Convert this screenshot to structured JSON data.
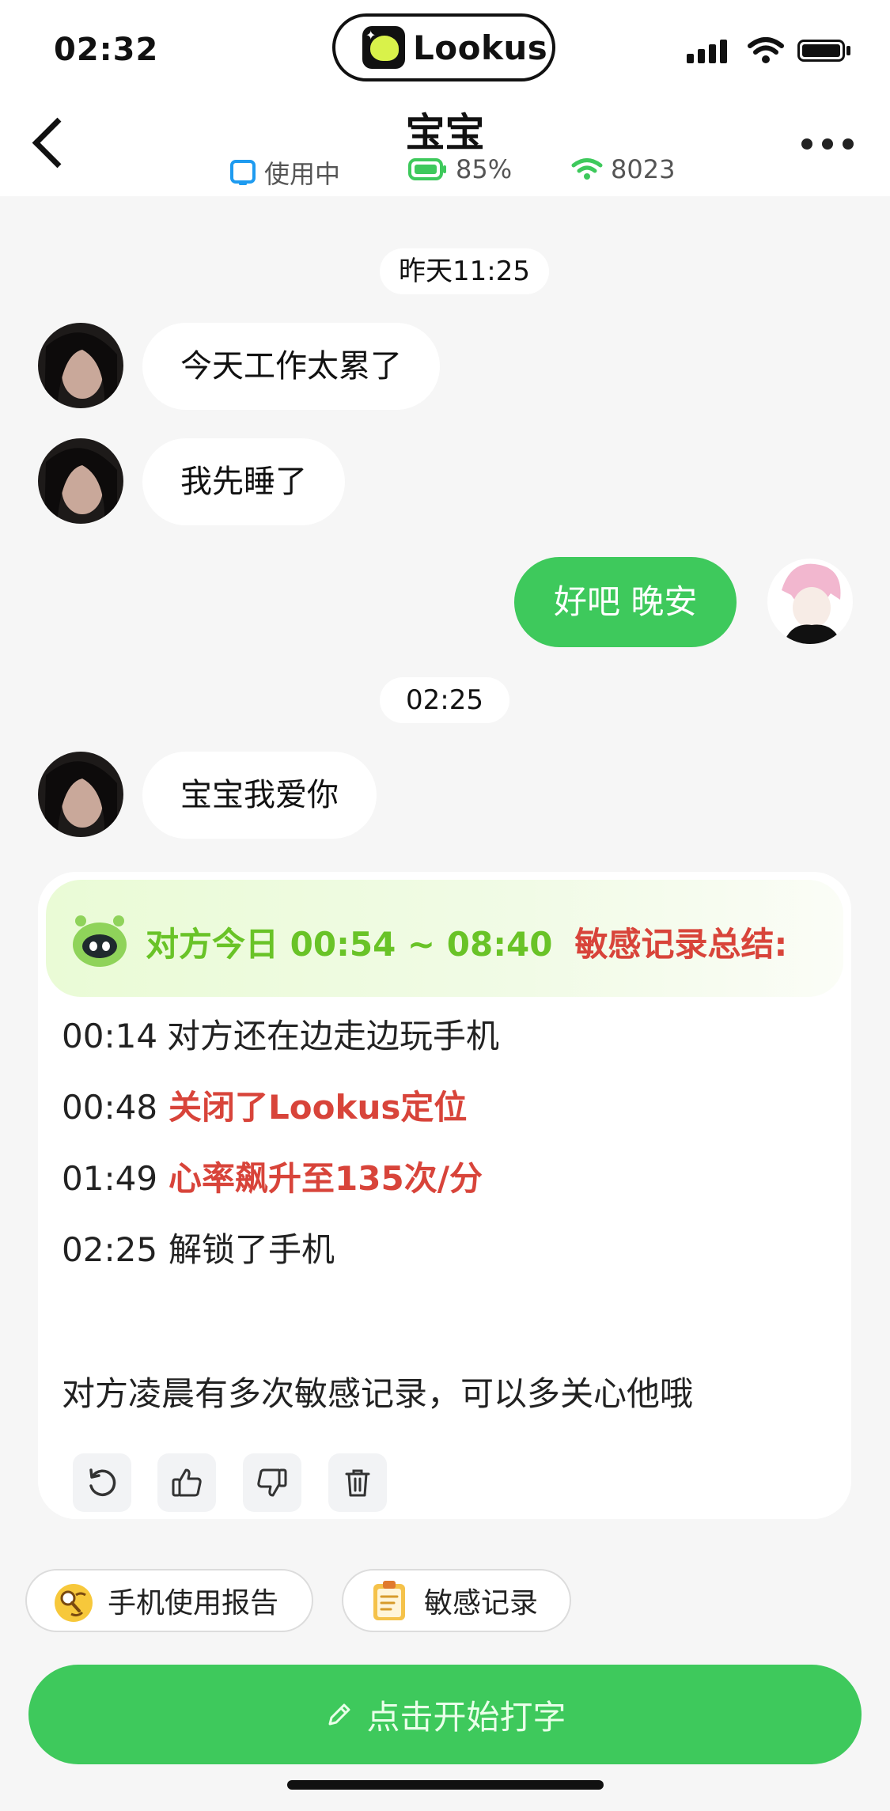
{
  "status_bar": {
    "time": "02:32"
  },
  "brand": {
    "name": "Lookus"
  },
  "header": {
    "title": "宝宝",
    "device_status": "使用中",
    "battery": "85%",
    "wifi": "8023"
  },
  "messages": [
    {
      "type": "timestamp",
      "text": "昨天11:25"
    },
    {
      "type": "incoming",
      "text": "今天工作太累了"
    },
    {
      "type": "incoming",
      "text": "我先睡了"
    },
    {
      "type": "outgoing",
      "text": "好吧 晚安"
    },
    {
      "type": "timestamp",
      "text": "02:25"
    },
    {
      "type": "incoming",
      "text": "宝宝我爱你"
    }
  ],
  "summary": {
    "range_label": "对方今日 00:54 ~ 08:40",
    "title_red": "敏感记录总结:",
    "records": [
      {
        "time": "00:14",
        "text": "对方还在边走边玩手机",
        "style": "plain"
      },
      {
        "time": "00:48",
        "text": "关闭了Lookus定位",
        "style": "alert"
      },
      {
        "time": "01:49",
        "text": "心率飙升至135次/分",
        "style": "alert"
      },
      {
        "time": "02:25",
        "text": "解锁了手机",
        "style": "plain"
      }
    ],
    "conclusion": "对方凌晨有多次敏感记录，可以多关心他哦"
  },
  "chips": [
    {
      "label": "手机使用报告",
      "icon": "magnifier-emoji-icon"
    },
    {
      "label": "敏感记录",
      "icon": "clipboard-icon"
    }
  ],
  "input": {
    "placeholder": "点击开始打字"
  },
  "colors": {
    "accent_green": "#3ec95c",
    "alert_red": "#d8443a",
    "summary_green": "#69c327"
  }
}
